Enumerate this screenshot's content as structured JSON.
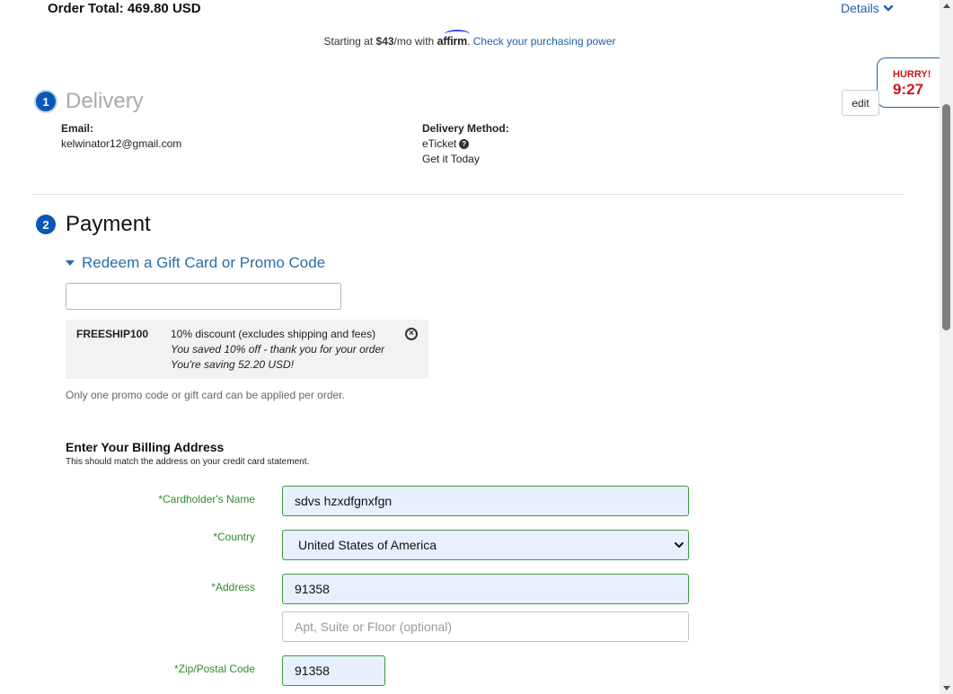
{
  "header": {
    "order_total": "Order Total: 469.80 USD",
    "details_label": "Details"
  },
  "affirm": {
    "prefix": "Starting at ",
    "amount": "$43",
    "suffix": "/mo with ",
    "logo_text": "affirm",
    "dot": ". ",
    "link": "Check your purchasing power"
  },
  "timer": {
    "label": "HURRY!",
    "time": "9:27",
    "color": "#d0161a"
  },
  "delivery": {
    "step": "1",
    "title": "Delivery",
    "edit_label": "edit",
    "email_label": "Email:",
    "email_value": "kelwinator12@gmail.com",
    "method_label": "Delivery Method:",
    "method_value": "eTicket",
    "method_help_icon": "?",
    "method_note": "Get it Today"
  },
  "payment": {
    "step": "2",
    "title": "Payment",
    "promo_toggle": "Redeem a Gift Card or Promo Code",
    "promo_input_value": "",
    "promo": {
      "code": "FREESHIP100",
      "description": "10% discount (excludes shipping and fees)",
      "saved": "You saved 10% off - thank you for your order",
      "saving": "You're saving 52.20 USD!"
    },
    "promo_note": "Only one promo code or gift card can be applied per order."
  },
  "billing": {
    "title": "Enter Your Billing Address",
    "subtitle": "This should match the address on your credit card statement.",
    "fields": {
      "cardholder_label": "*Cardholder's Name",
      "cardholder_value": "sdvs hzxdfgnxfgn",
      "country_label": "*Country",
      "country_value": "United States of America",
      "address_label": "*Address",
      "address_value": "91358",
      "address2_placeholder": "Apt, Suite or Floor (optional)",
      "zip_label": "*Zip/Postal Code",
      "zip_value": "91358"
    }
  },
  "colors": {
    "accent": "#0a58b5",
    "link": "#1f5fa6",
    "valid_green": "#3c9a3c",
    "autofill_bg": "#e8f0fe"
  }
}
